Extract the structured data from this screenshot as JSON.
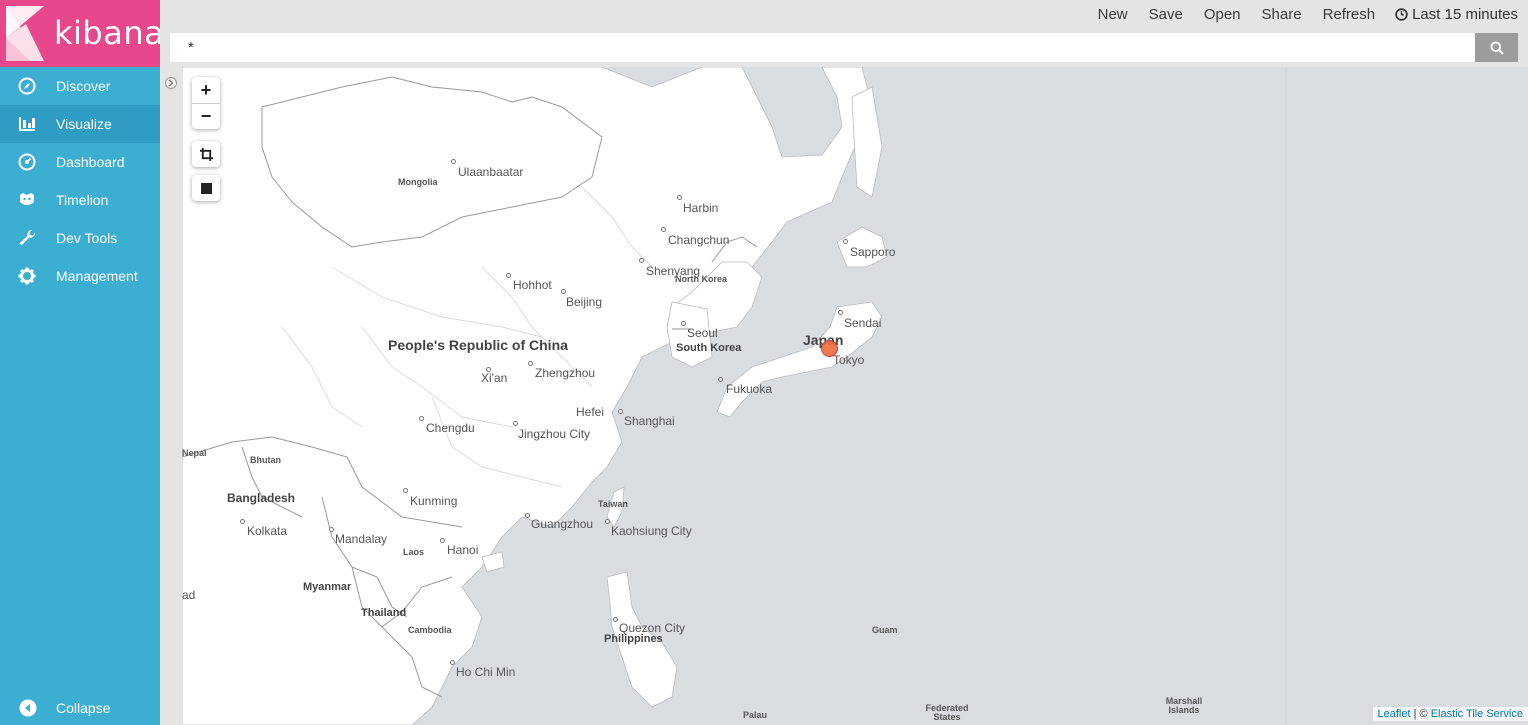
{
  "app": {
    "logo_text": "kibana",
    "brand_color": "#e8488b",
    "sidebar_color": "#3caed2"
  },
  "sidebar": {
    "items": [
      {
        "label": "Discover",
        "icon": "compass-icon"
      },
      {
        "label": "Visualize",
        "icon": "bar-chart-icon"
      },
      {
        "label": "Dashboard",
        "icon": "dashboard-icon"
      },
      {
        "label": "Timelion",
        "icon": "timelion-icon"
      },
      {
        "label": "Dev Tools",
        "icon": "wrench-icon"
      },
      {
        "label": "Management",
        "icon": "gear-icon"
      }
    ],
    "active": "Visualize",
    "collapse_label": "Collapse"
  },
  "topnav": {
    "new_label": "New",
    "save_label": "Save",
    "open_label": "Open",
    "share_label": "Share",
    "refresh_label": "Refresh",
    "time_label": "Last 15 minutes"
  },
  "search": {
    "value": "*"
  },
  "map": {
    "zoom_in": "+",
    "zoom_out": "−",
    "countries": {
      "china": "People's Republic of China",
      "mongolia": "Mongolia",
      "japan": "Japan",
      "north_korea": "North Korea",
      "south_korea": "South Korea",
      "bangladesh": "Bangladesh",
      "bhutan": "Bhutan",
      "nepal": "Nepal",
      "myanmar": "Myanmar",
      "thailand": "Thailand",
      "laos": "Laos",
      "cambodia": "Cambodia",
      "philippines": "Philippines",
      "taiwan": "Taiwan",
      "guam": "Guam",
      "palau": "Palau",
      "federated_states": "Federated States",
      "marshall_islands": "Marshall Islands",
      "edge_ad": "ad"
    },
    "cities": {
      "ulaanbaatar": "Ulaanbaatar",
      "harbin": "Harbin",
      "changchun": "Changchun",
      "shenyang": "Shenyang",
      "hohhot": "Hohhot",
      "beijing": "Beijing",
      "seoul": "Seoul",
      "sapporo": "Sapporo",
      "sendai": "Sendai",
      "tokyo": "Tokyo",
      "fukuoka": "Fukuoka",
      "xian": "Xi'an",
      "zhengzhou": "Zhengzhou",
      "hefei": "Hefei",
      "shanghai": "Shanghai",
      "chengdu": "Chengdu",
      "jingzhou": "Jingzhou City",
      "kunming": "Kunming",
      "guangzhou": "Guangzhou",
      "kaohsiung": "Kaohsiung City",
      "kolkata": "Kolkata",
      "mandalay": "Mandalay",
      "hanoi": "Hanoi",
      "quezon": "Quezon City",
      "hochiminh": "Ho Chi Min"
    },
    "attribution": {
      "leaflet": "Leaflet",
      "sep": "| ©",
      "service": "Elastic Tile Service"
    },
    "marker_color": "#f06b3c"
  }
}
